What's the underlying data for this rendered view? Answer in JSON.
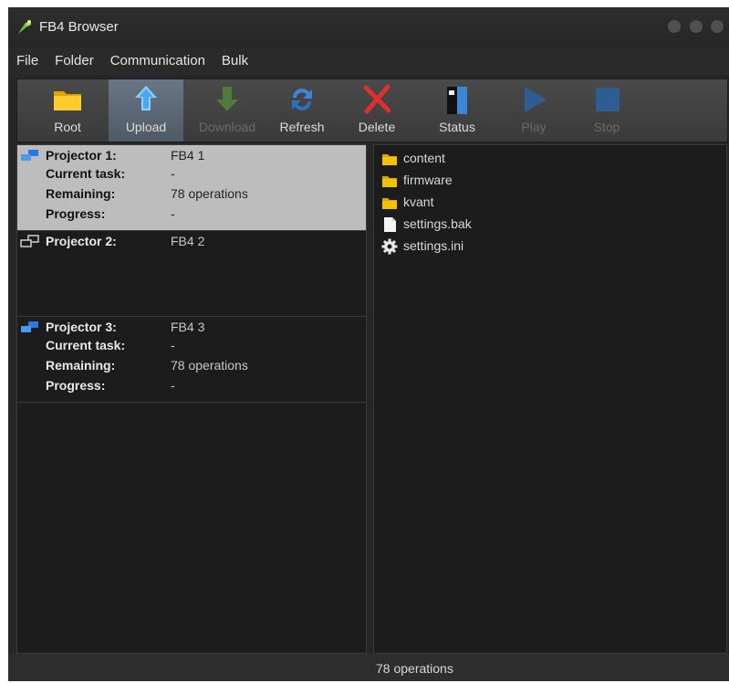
{
  "window": {
    "title": "FB4 Browser"
  },
  "menu": [
    "File",
    "Folder",
    "Communication",
    "Bulk"
  ],
  "toolbar": {
    "root": "Root",
    "upload": "Upload",
    "download": "Download",
    "refresh": "Refresh",
    "delete": "Delete",
    "status": "Status",
    "play": "Play",
    "stop": "Stop"
  },
  "projectors": [
    {
      "label": "Projector 1:",
      "name": "FB4 1",
      "task_label": "Current task:",
      "task": "-",
      "remaining_label": "Remaining:",
      "remaining": "78 operations",
      "progress_label": "Progress:",
      "progress": "-"
    },
    {
      "label": "Projector 2:",
      "name": "FB4 2"
    },
    {
      "label": "Projector 3:",
      "name": "FB4 3",
      "task_label": "Current task:",
      "task": "-",
      "remaining_label": "Remaining:",
      "remaining": "78 operations",
      "progress_label": "Progress:",
      "progress": "-"
    }
  ],
  "files": [
    {
      "name": "content",
      "icon": "folder-icon"
    },
    {
      "name": "firmware",
      "icon": "folder-icon"
    },
    {
      "name": "kvant",
      "icon": "folder-icon"
    },
    {
      "name": "settings.bak",
      "icon": "file-icon"
    },
    {
      "name": "settings.ini",
      "icon": "gear-icon"
    }
  ],
  "status": "78 operations",
  "colors": {
    "selection": "#bdbdbd",
    "folder": "#f2c200",
    "accent": "#3a86d8",
    "delete": "#e0302a"
  }
}
